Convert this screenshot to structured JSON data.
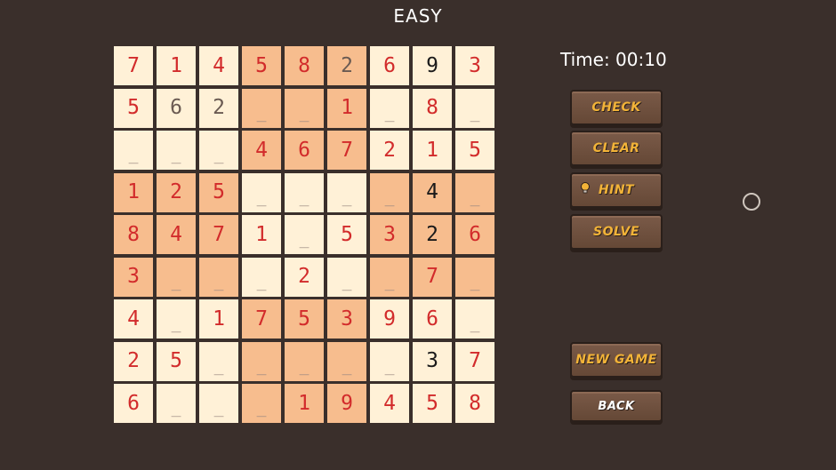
{
  "header": {
    "title": "EASY"
  },
  "timer": {
    "text": "Time: 00:10"
  },
  "buttons": {
    "check": "CHECK",
    "clear": "CLEAR",
    "hint": "HINT",
    "solve": "SOLVE",
    "new_game": "NEW GAME",
    "back": "BACK"
  },
  "board": {
    "blank_symbol": "_",
    "cells": [
      [
        {
          "v": "7",
          "s": "red"
        },
        {
          "v": "1",
          "s": "red"
        },
        {
          "v": "4",
          "s": "red"
        },
        {
          "v": "5",
          "s": "red"
        },
        {
          "v": "8",
          "s": "red"
        },
        {
          "v": "2",
          "s": "gray"
        },
        {
          "v": "6",
          "s": "red"
        },
        {
          "v": "9",
          "s": "black"
        },
        {
          "v": "3",
          "s": "red"
        }
      ],
      [
        {
          "v": "5",
          "s": "red"
        },
        {
          "v": "6",
          "s": "gray"
        },
        {
          "v": "2",
          "s": "gray"
        },
        {
          "v": "_",
          "s": "blank"
        },
        {
          "v": "_",
          "s": "blank"
        },
        {
          "v": "1",
          "s": "red"
        },
        {
          "v": "_",
          "s": "blank"
        },
        {
          "v": "8",
          "s": "red"
        },
        {
          "v": "_",
          "s": "blank"
        }
      ],
      [
        {
          "v": "_",
          "s": "blank"
        },
        {
          "v": "_",
          "s": "blank"
        },
        {
          "v": "_",
          "s": "blank"
        },
        {
          "v": "4",
          "s": "red"
        },
        {
          "v": "6",
          "s": "red"
        },
        {
          "v": "7",
          "s": "red"
        },
        {
          "v": "2",
          "s": "red"
        },
        {
          "v": "1",
          "s": "red"
        },
        {
          "v": "5",
          "s": "red"
        }
      ],
      [
        {
          "v": "1",
          "s": "red"
        },
        {
          "v": "2",
          "s": "red"
        },
        {
          "v": "5",
          "s": "red"
        },
        {
          "v": "_",
          "s": "blank"
        },
        {
          "v": "_",
          "s": "blank"
        },
        {
          "v": "_",
          "s": "blank"
        },
        {
          "v": "_",
          "s": "blank"
        },
        {
          "v": "4",
          "s": "black"
        },
        {
          "v": "_",
          "s": "blank"
        }
      ],
      [
        {
          "v": "8",
          "s": "red"
        },
        {
          "v": "4",
          "s": "red"
        },
        {
          "v": "7",
          "s": "red"
        },
        {
          "v": "1",
          "s": "red"
        },
        {
          "v": "_",
          "s": "blank"
        },
        {
          "v": "5",
          "s": "red"
        },
        {
          "v": "3",
          "s": "red"
        },
        {
          "v": "2",
          "s": "black"
        },
        {
          "v": "6",
          "s": "red"
        }
      ],
      [
        {
          "v": "3",
          "s": "red"
        },
        {
          "v": "_",
          "s": "blank"
        },
        {
          "v": "_",
          "s": "blank"
        },
        {
          "v": "_",
          "s": "blank"
        },
        {
          "v": "2",
          "s": "red"
        },
        {
          "v": "_",
          "s": "blank"
        },
        {
          "v": "_",
          "s": "blank"
        },
        {
          "v": "7",
          "s": "red"
        },
        {
          "v": "_",
          "s": "blank"
        }
      ],
      [
        {
          "v": "4",
          "s": "red"
        },
        {
          "v": "_",
          "s": "blank"
        },
        {
          "v": "1",
          "s": "red"
        },
        {
          "v": "7",
          "s": "red"
        },
        {
          "v": "5",
          "s": "red"
        },
        {
          "v": "3",
          "s": "red"
        },
        {
          "v": "9",
          "s": "red"
        },
        {
          "v": "6",
          "s": "red"
        },
        {
          "v": "_",
          "s": "blank"
        }
      ],
      [
        {
          "v": "2",
          "s": "red"
        },
        {
          "v": "5",
          "s": "red"
        },
        {
          "v": "_",
          "s": "blank"
        },
        {
          "v": "_",
          "s": "blank"
        },
        {
          "v": "_",
          "s": "blank"
        },
        {
          "v": "_",
          "s": "blank"
        },
        {
          "v": "_",
          "s": "blank"
        },
        {
          "v": "3",
          "s": "black"
        },
        {
          "v": "7",
          "s": "red"
        }
      ],
      [
        {
          "v": "6",
          "s": "red"
        },
        {
          "v": "_",
          "s": "blank"
        },
        {
          "v": "_",
          "s": "blank"
        },
        {
          "v": "_",
          "s": "blank"
        },
        {
          "v": "1",
          "s": "red"
        },
        {
          "v": "9",
          "s": "red"
        },
        {
          "v": "4",
          "s": "red"
        },
        {
          "v": "5",
          "s": "red"
        },
        {
          "v": "8",
          "s": "red"
        }
      ]
    ]
  },
  "colors": {
    "background": "#3a2f2b",
    "cell_light": "#fff1d7",
    "cell_dark": "#f7bd8e",
    "digit_given": "#d22b2b",
    "digit_entered": "#1a1a1a",
    "button_text": "#f2b338"
  },
  "icons": {
    "hint": "lightbulb-icon",
    "cursor": "circle-cursor-icon"
  }
}
